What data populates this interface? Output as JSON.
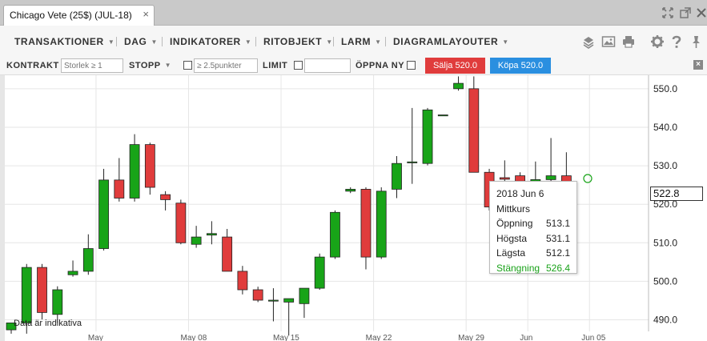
{
  "tab": {
    "title": "Chicago Vete (25$) (JUL-18)",
    "close": "×"
  },
  "menu": {
    "items": [
      {
        "label": "TRANSAKTIONER"
      },
      {
        "label": "DAG"
      },
      {
        "label": "INDIKATORER"
      },
      {
        "label": "RITOBJEKT"
      },
      {
        "label": "LARM"
      },
      {
        "label": "DIAGRAMLAYOUTER"
      }
    ],
    "caret": "▼",
    "icons": [
      "layers-icon",
      "image-icon",
      "print-icon",
      "gear-icon",
      "help-icon",
      "pin-icon"
    ]
  },
  "trade": {
    "contract_label": "KONTRAKT",
    "contract_placeholder": "Storlek ≥ 1",
    "stop_label": "STOPP",
    "stop_placeholder": "≥ 2.5punkter",
    "limit_label": "LIMIT",
    "open_new_label": "ÖPPNA NY",
    "sell_label": "Sälja 520.0",
    "buy_label": "Köpa 520.0",
    "sell_color": "#e03c3c",
    "buy_color": "#2a8fe0",
    "close": "×"
  },
  "current_price": "522.8",
  "disclaimer": "Data är indikativa",
  "tooltip": {
    "date": "2018 Jun 6",
    "series": "Mittkurs",
    "rows": [
      {
        "label": "Öppning",
        "value": "513.1"
      },
      {
        "label": "Högsta",
        "value": "531.1"
      },
      {
        "label": "Lägsta",
        "value": "512.1"
      },
      {
        "label": "Stängning",
        "value": "526.4"
      }
    ]
  },
  "chart_data": {
    "type": "candlestick",
    "up_color": "#18a418",
    "down_color": "#e03c3c",
    "ylim": [
      484.5,
      553.5
    ],
    "y_ticks": [
      "490.0",
      "500.0",
      "510.0",
      "520.0",
      "530.0",
      "540.0",
      "550.0"
    ],
    "x_ticks": [
      "May",
      "May 08",
      "May 15",
      "May 22",
      "May 29",
      "Jun",
      "Jun 05"
    ],
    "candles": [
      {
        "open": 487.4,
        "high": 488.3,
        "low": 486.4,
        "close": 489.2
      },
      {
        "open": 489.2,
        "high": 504.5,
        "low": 486.4,
        "close": 503.6
      },
      {
        "open": 503.6,
        "high": 504.5,
        "low": 490.1,
        "close": 491.9
      },
      {
        "open": 491.4,
        "high": 498.7,
        "low": 489.2,
        "close": 497.8
      },
      {
        "open": 501.7,
        "high": 505.4,
        "low": 501.2,
        "close": 502.6
      },
      {
        "open": 502.6,
        "high": 512.2,
        "low": 501.7,
        "close": 508.5
      },
      {
        "open": 508.5,
        "high": 529.2,
        "low": 508.0,
        "close": 526.3
      },
      {
        "open": 526.3,
        "high": 532.0,
        "low": 520.7,
        "close": 521.6
      },
      {
        "open": 521.6,
        "high": 538.2,
        "low": 520.7,
        "close": 535.5
      },
      {
        "open": 535.5,
        "high": 536.0,
        "low": 522.5,
        "close": 524.4
      },
      {
        "open": 522.5,
        "high": 523.4,
        "low": 518.4,
        "close": 521.2
      },
      {
        "open": 520.3,
        "high": 521.2,
        "low": 509.6,
        "close": 510.0
      },
      {
        "open": 509.6,
        "high": 514.4,
        "low": 508.7,
        "close": 511.5
      },
      {
        "open": 512.0,
        "high": 515.6,
        "low": 509.6,
        "close": 512.4
      },
      {
        "open": 511.5,
        "high": 513.6,
        "low": 506.4,
        "close": 502.6
      },
      {
        "open": 502.6,
        "high": 504.0,
        "low": 496.6,
        "close": 497.8
      },
      {
        "open": 497.8,
        "high": 498.6,
        "low": 494.6,
        "close": 495.1
      },
      {
        "open": 495.1,
        "high": 498.2,
        "low": 489.6,
        "close": 495.1
      },
      {
        "open": 494.6,
        "high": 495.1,
        "low": 485.9,
        "close": 495.5
      },
      {
        "open": 494.2,
        "high": 498.2,
        "low": 490.5,
        "close": 498.2
      },
      {
        "open": 498.2,
        "high": 507.2,
        "low": 497.8,
        "close": 506.3
      },
      {
        "open": 506.3,
        "high": 518.4,
        "low": 505.8,
        "close": 517.9
      },
      {
        "open": 523.4,
        "high": 524.4,
        "low": 522.9,
        "close": 523.9
      },
      {
        "open": 523.9,
        "high": 524.4,
        "low": 503.1,
        "close": 506.3
      },
      {
        "open": 506.3,
        "high": 524.4,
        "low": 505.8,
        "close": 523.4
      },
      {
        "open": 523.9,
        "high": 532.5,
        "low": 521.6,
        "close": 530.6
      },
      {
        "open": 531.0,
        "high": 545.0,
        "low": 525.3,
        "close": 531.0
      },
      {
        "open": 530.6,
        "high": 545.0,
        "low": 530.1,
        "close": 544.5
      },
      {
        "open": 543.2,
        "high": 543.2,
        "low": 543.2,
        "close": 543.2
      },
      {
        "open": 550.0,
        "high": 553.2,
        "low": 549.5,
        "close": 551.4
      },
      {
        "open": 550.0,
        "high": 553.2,
        "low": 528.3,
        "close": 528.3
      },
      {
        "open": 528.3,
        "high": 529.2,
        "low": 518.4,
        "close": 519.3
      },
      {
        "open": 526.9,
        "high": 531.4,
        "low": 524.4,
        "close": 526.5
      },
      {
        "open": 527.4,
        "high": 528.3,
        "low": 522.0,
        "close": 526.0
      },
      {
        "open": 513.1,
        "high": 531.1,
        "low": 512.1,
        "close": 526.4
      },
      {
        "open": 526.4,
        "high": 537.2,
        "low": 523.4,
        "close": 527.4
      },
      {
        "open": 527.4,
        "high": 533.5,
        "low": 513.6,
        "close": 523.0
      }
    ]
  }
}
